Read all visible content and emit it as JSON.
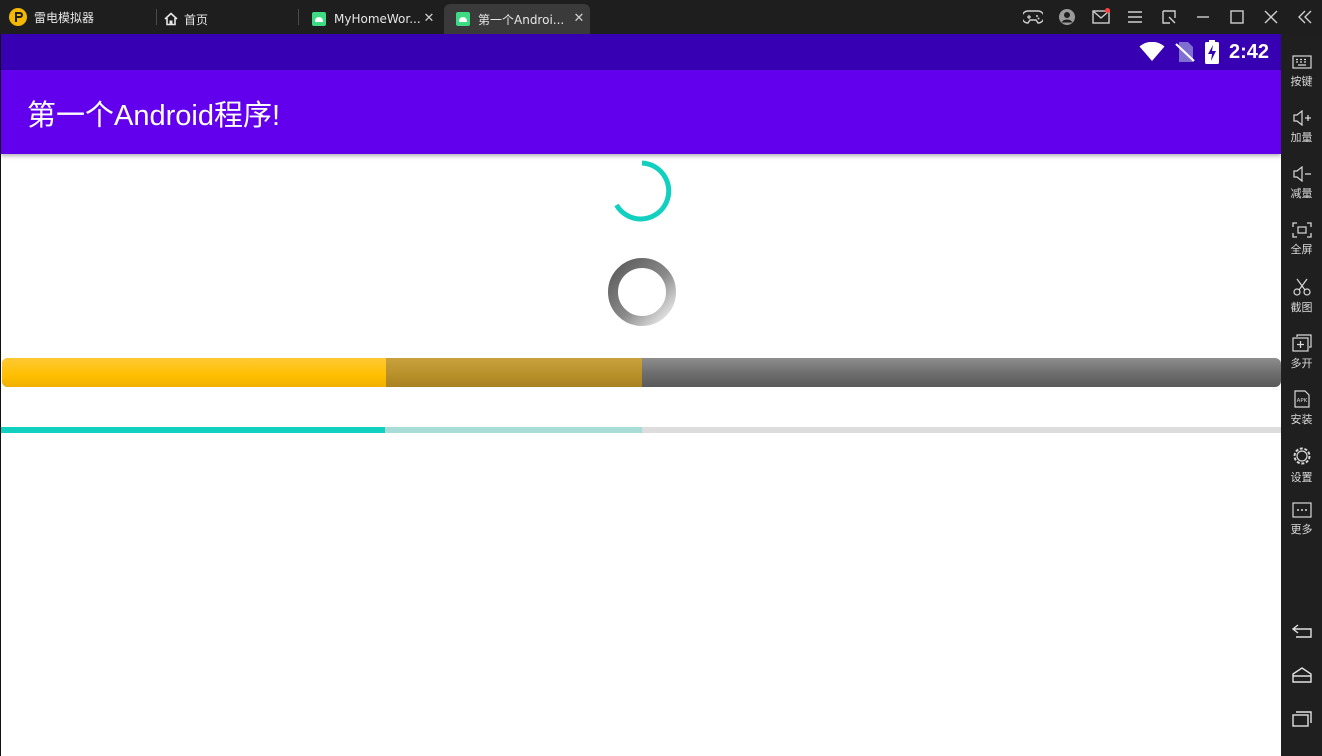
{
  "emulator": {
    "app_name": "雷电模拟器",
    "tabs": [
      {
        "label": "首页"
      },
      {
        "label": "MyHomeWor..."
      },
      {
        "label": "第一个Androi..."
      }
    ]
  },
  "status_bar": {
    "time": "2:42"
  },
  "app": {
    "title": "第一个Android程序!"
  },
  "progress": {
    "thick_bar": {
      "primary": 0.3,
      "secondary": 0.5
    },
    "thin_bar": {
      "primary": 0.3,
      "secondary": 0.5
    }
  },
  "sidebar": {
    "items": [
      {
        "label": "按键",
        "icon": "keyboard-icon"
      },
      {
        "label": "加量",
        "icon": "volume-up-icon"
      },
      {
        "label": "减量",
        "icon": "volume-down-icon"
      },
      {
        "label": "全屏",
        "icon": "fullscreen-icon"
      },
      {
        "label": "截图",
        "icon": "scissors-icon"
      },
      {
        "label": "多开",
        "icon": "multi-instance-icon"
      },
      {
        "label": "安装",
        "icon": "apk-icon"
      },
      {
        "label": "设置",
        "icon": "gear-icon"
      },
      {
        "label": "更多",
        "icon": "more-icon"
      }
    ]
  },
  "colors": {
    "status_bar": "#3700b3",
    "app_bar": "#6200ee",
    "accent_teal": "#12d0c0",
    "progress_yellow": "#ffbf00"
  }
}
